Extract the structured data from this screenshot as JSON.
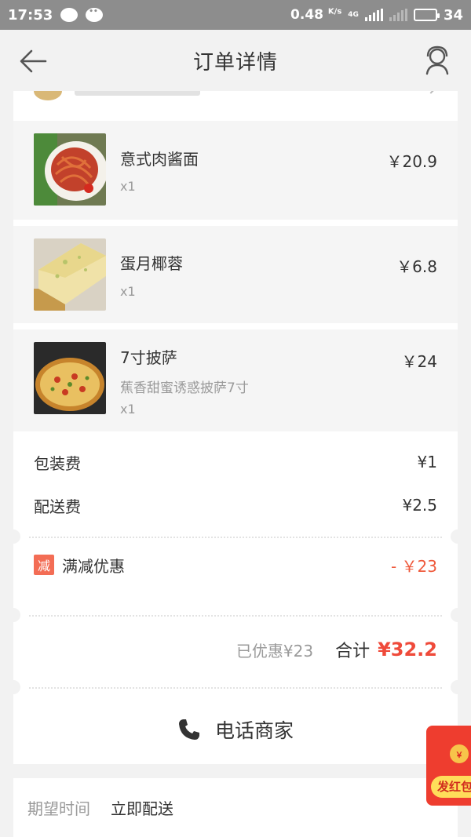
{
  "status_bar": {
    "time": "17:53",
    "net_speed": "0.48",
    "net_unit": "K/s",
    "network_type": "4G",
    "battery": "34"
  },
  "header": {
    "title": "订单详情"
  },
  "items": [
    {
      "name": "意式肉酱面",
      "qty": "x1",
      "price": "￥20.9",
      "spec": ""
    },
    {
      "name": "蛋月椰蓉",
      "qty": "x1",
      "price": "￥6.8",
      "spec": ""
    },
    {
      "name": "7寸披萨",
      "qty": "x1",
      "price": "￥24",
      "spec": "蕉香甜蜜诱惑披萨7寸"
    }
  ],
  "fees": {
    "packing_label": "包装费",
    "packing_value": "¥1",
    "delivery_label": "配送费",
    "delivery_value": "¥2.5"
  },
  "discount": {
    "badge": "减",
    "label": "满减优惠",
    "value": "- ￥23"
  },
  "total": {
    "saved": "已优惠¥23",
    "label": "合计",
    "value": "¥32.2"
  },
  "call_merchant": "电话商家",
  "delivery": {
    "label": "期望时间",
    "value": "立即配送"
  },
  "red_envelope": {
    "coin": "￥",
    "label": "发红包"
  },
  "colors": {
    "accent": "#ef4a3a",
    "discount_badge": "#f36d55",
    "status_bar": "#8d8d8d"
  }
}
